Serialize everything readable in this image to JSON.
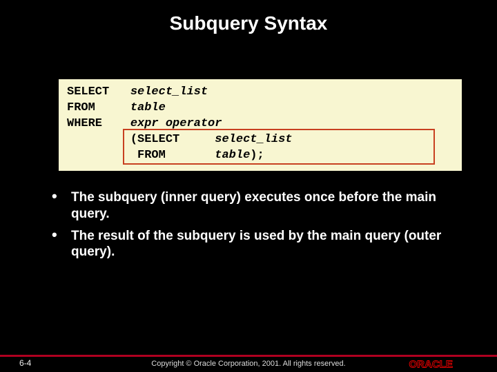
{
  "title": "Subquery Syntax",
  "code": {
    "l1_kw": "SELECT",
    "l1_it": "select_list",
    "l2_kw": "FROM",
    "l2_it": "table",
    "l3_kw": "WHERE",
    "l3_it": "expr operator",
    "l4_open": "(SELECT",
    "l4_it": "select_list",
    "l5_kw": "FROM",
    "l5_it": "table",
    "l5_close": ");"
  },
  "bullets": [
    "The subquery (inner query) executes once before the main query.",
    "The result of the subquery is used by the main query (outer query)."
  ],
  "page_number": "6-4",
  "copyright": "Copyright © Oracle Corporation, 2001. All rights reserved.",
  "logo_text": "ORACLE"
}
